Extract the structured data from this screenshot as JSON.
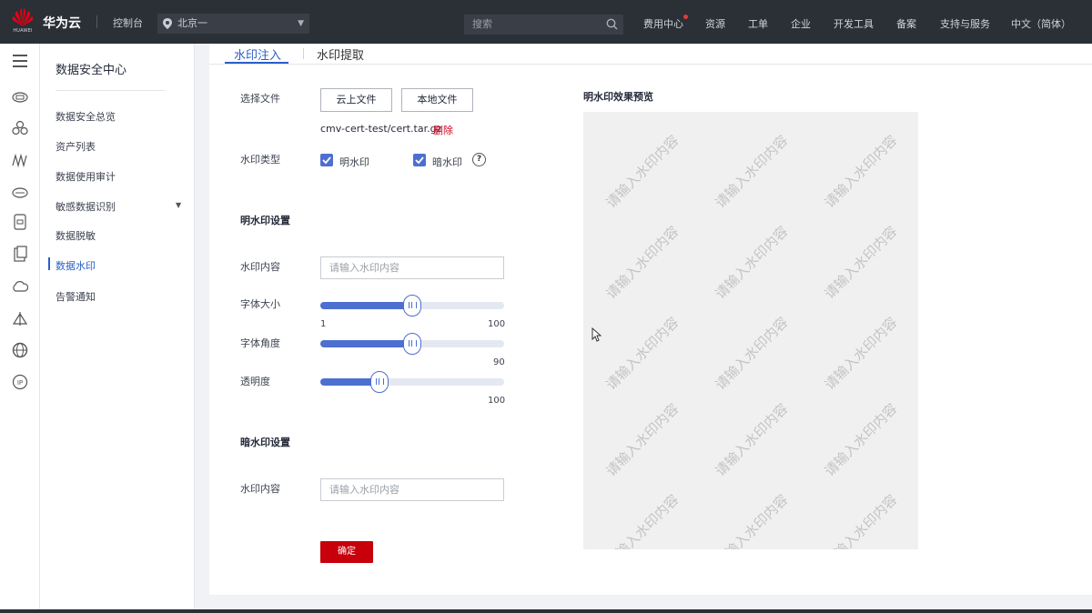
{
  "topbar": {
    "logo_text": "HUAWEI",
    "brand": "华为云",
    "console": "控制台",
    "region": "北京一",
    "search_placeholder": "搜索",
    "links": [
      "费用中心",
      "资源",
      "工单",
      "企业",
      "开发工具",
      "备案",
      "支持与服务",
      "中文（简体）"
    ]
  },
  "rail_icons": [
    "menu-icon",
    "cloud-server-icon",
    "cluster-icon",
    "network-icon",
    "storage-icon",
    "database-icon",
    "document-icon",
    "cloud-icon",
    "deploy-icon",
    "globe-icon",
    "ip-icon"
  ],
  "snav": {
    "title": "数据安全中心",
    "items": [
      "数据安全总览",
      "资产列表",
      "数据使用审计",
      "敏感数据识别",
      "数据脱敏",
      "数据水印",
      "告警通知"
    ],
    "active_item": "数据水印"
  },
  "tabs": [
    "水印注入",
    "水印提取"
  ],
  "form": {
    "select_file_label": "选择文件",
    "cloud_file_button": "云上文件",
    "local_file_button": "本地文件",
    "filename": "cmv-cert-test/cert.tar.gz",
    "delete_label": "删除",
    "watermark_type_label": "水印类型",
    "visible_option": "明水印",
    "visible_checked": true,
    "invisible_option": "暗水印",
    "invisible_checked": true,
    "help_icon": "?",
    "visible_section_title": "明水印设置",
    "content_label": "水印内容",
    "content_placeholder": "请输入水印内容",
    "font_size_label": "字体大小",
    "font_size_min": "1",
    "font_size_max": "100",
    "font_size_value": 50,
    "font_angle_label": "字体角度",
    "font_angle_max": "90",
    "font_angle_value": 45,
    "opacity_label": "透明度",
    "opacity_max": "100",
    "opacity_value": 32,
    "invisible_section_title": "暗水印设置",
    "invisible_content_label": "水印内容",
    "invisible_content_placeholder": "请输入水印内容",
    "confirm_button": "确定"
  },
  "preview": {
    "title": "明水印效果预览",
    "watermark_text": "请输入水印内容"
  },
  "colors": {
    "accent": "#4d6fd0",
    "brand_red": "#c7000b",
    "topbar": "#2b2f36"
  }
}
